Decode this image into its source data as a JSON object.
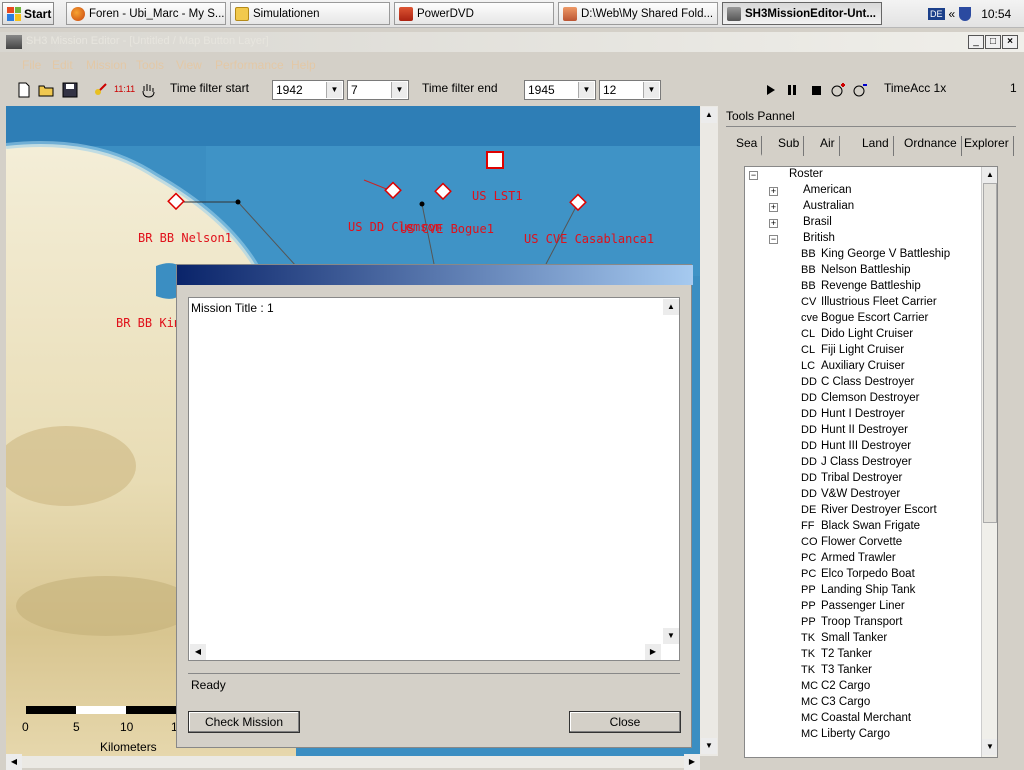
{
  "taskbar": {
    "start_label": "Start",
    "tasks": [
      {
        "label": "Foren - Ubi_Marc - My S...",
        "icon": "firefox-icon"
      },
      {
        "label": "Simulationen",
        "icon": "folder-icon"
      },
      {
        "label": "PowerDVD",
        "icon": "powerdvd-icon"
      },
      {
        "label": "D:\\Web\\My Shared Fold...",
        "icon": "explorer-icon"
      },
      {
        "label": "SH3MissionEditor-Unt...",
        "icon": "editor-icon"
      }
    ],
    "lang": "DE",
    "tray_arrows": "«",
    "clock": "10:54"
  },
  "window": {
    "title": "SH3 Mission Editor - [Untitled / Map Button Layer]"
  },
  "menu": [
    "File",
    "Edit",
    "Mission",
    "Tools",
    "View",
    "Performance",
    "Help"
  ],
  "toolbar": {
    "time_display": "11:11",
    "filter_start_label": "Time filter start",
    "filter_start_year": "1942",
    "filter_start_month": "7",
    "filter_end_label": "Time filter end",
    "filter_end_year": "1945",
    "filter_end_month": "12",
    "timeacc_label": "TimeAcc 1x",
    "timeacc_value": "1"
  },
  "map": {
    "labels": [
      {
        "text": "BR  BB  Nelson1",
        "name": "map-label-nelson"
      },
      {
        "text": "US  DD  Clemson",
        "name": "map-label-clemson"
      },
      {
        "text": "US CVE  Bogue1",
        "name": "map-label-bogue"
      },
      {
        "text": "US  LST1",
        "name": "map-label-lst"
      },
      {
        "text": "US  CVE  Casablanca1",
        "name": "map-label-casablanca"
      },
      {
        "text": "BR  BB  King",
        "name": "map-label-king"
      }
    ],
    "scale": {
      "ticks": [
        "0",
        "5",
        "10",
        "1"
      ],
      "unit": "Kilometers"
    }
  },
  "dialog": {
    "mission_title": "Mission Title : 1",
    "status": "Ready",
    "check_label": "Check Mission",
    "close_label": "Close"
  },
  "tools": {
    "title": "Tools Pannel",
    "tabs": [
      "Sea",
      "Sub",
      "Air",
      "Land",
      "Ordnance",
      "Explorer"
    ],
    "root": "Roster",
    "nations": [
      "American",
      "Australian",
      "Brasil",
      "British"
    ],
    "british_units": [
      {
        "cls": "BB",
        "name": "King George V Battleship"
      },
      {
        "cls": "BB",
        "name": "Nelson Battleship"
      },
      {
        "cls": "BB",
        "name": "Revenge Battleship"
      },
      {
        "cls": "CV",
        "name": "Illustrious Fleet Carrier"
      },
      {
        "cls": "cve",
        "name": "Bogue Escort Carrier"
      },
      {
        "cls": "CL",
        "name": "Dido Light Cruiser"
      },
      {
        "cls": "CL",
        "name": "Fiji Light Cruiser"
      },
      {
        "cls": "LC",
        "name": "Auxiliary Cruiser"
      },
      {
        "cls": "DD",
        "name": "C Class Destroyer"
      },
      {
        "cls": "DD",
        "name": "Clemson Destroyer"
      },
      {
        "cls": "DD",
        "name": "Hunt I Destroyer"
      },
      {
        "cls": "DD",
        "name": "Hunt II Destroyer"
      },
      {
        "cls": "DD",
        "name": "Hunt III Destroyer"
      },
      {
        "cls": "DD",
        "name": "J Class Destroyer"
      },
      {
        "cls": "DD",
        "name": "Tribal Destroyer"
      },
      {
        "cls": "DD",
        "name": "V&W Destroyer"
      },
      {
        "cls": "DE",
        "name": "River Destroyer Escort"
      },
      {
        "cls": "FF",
        "name": "Black Swan Frigate"
      },
      {
        "cls": "CO",
        "name": "Flower Corvette"
      },
      {
        "cls": "PC",
        "name": "Armed Trawler"
      },
      {
        "cls": "PC",
        "name": "Elco Torpedo Boat"
      },
      {
        "cls": "PP",
        "name": "Landing Ship Tank"
      },
      {
        "cls": "PP",
        "name": "Passenger Liner"
      },
      {
        "cls": "PP",
        "name": "Troop Transport"
      },
      {
        "cls": "TK",
        "name": "Small Tanker"
      },
      {
        "cls": "TK",
        "name": "T2 Tanker"
      },
      {
        "cls": "TK",
        "name": "T3 Tanker"
      },
      {
        "cls": "MC",
        "name": "C2 Cargo"
      },
      {
        "cls": "MC",
        "name": "C3 Cargo"
      },
      {
        "cls": "MC",
        "name": "Coastal Merchant"
      },
      {
        "cls": "MC",
        "name": "Liberty Cargo"
      }
    ]
  },
  "colors": {
    "sea": "#3b8ec2",
    "land": "#f2ead0",
    "unit_red": "#e0101a",
    "dialog_title_start": "#0a246a",
    "dialog_title_end": "#a6caf0"
  }
}
